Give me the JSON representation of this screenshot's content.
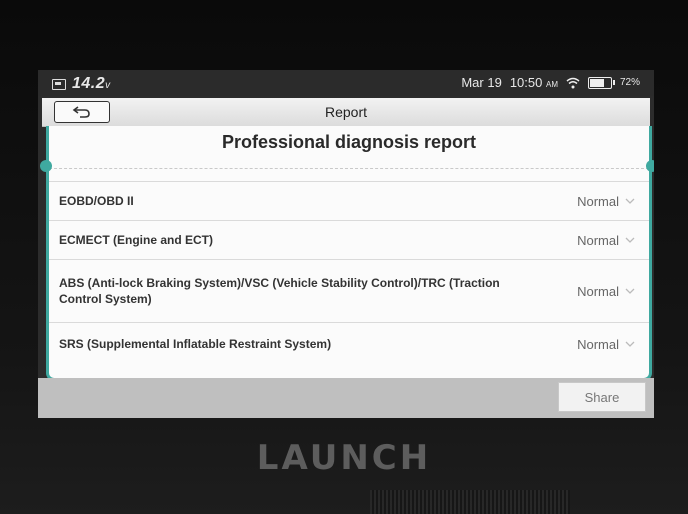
{
  "status_bar": {
    "voltage": "14.2",
    "voltage_unit": "v",
    "date": "Mar 19",
    "time": "10:50",
    "ampm": "AM",
    "battery": "72%"
  },
  "header": {
    "title": "Report",
    "back_icon": "back-arrow-icon"
  },
  "report": {
    "title": "Professional diagnosis report",
    "rows": [
      {
        "name": "EOBD/OBD II",
        "status": "Normal"
      },
      {
        "name": "ECMECT (Engine and ECT)",
        "status": "Normal"
      },
      {
        "name": "ABS (Anti-lock Braking System)/VSC (Vehicle Stability Control)/TRC (Traction Control System)",
        "status": "Normal"
      },
      {
        "name": "SRS (Supplemental Inflatable Restraint System)",
        "status": "Normal"
      }
    ]
  },
  "footer": {
    "share_label": "Share"
  },
  "device": {
    "brand": "LAUNCH"
  },
  "colors": {
    "accent": "#3fa9a0",
    "status_bar": "#2b2b2b",
    "bottom_bar": "#bfbfbf"
  }
}
